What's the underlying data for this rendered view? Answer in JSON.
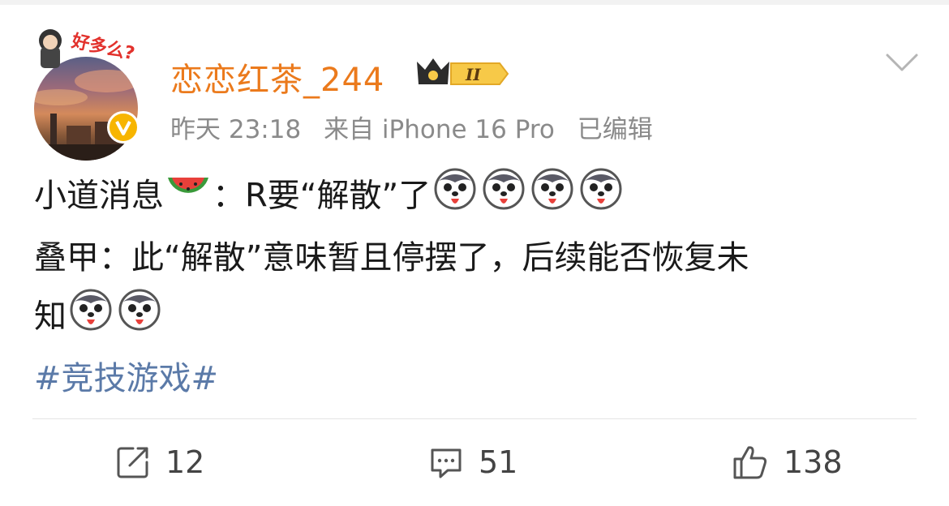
{
  "post": {
    "username": "恋恋红茶_244",
    "vip_level": "II",
    "meta": {
      "time": "昨天 23:18",
      "source": "来自 iPhone 16 Pro",
      "edited": "已编辑"
    },
    "content": {
      "line1_text_a": "小道消息",
      "line1_text_b": "：R要“解散”了",
      "line2_text": "叠甲：此“解散”意味暂且停摆了，后续能否恢复未",
      "line3_text": "知",
      "hashtag": "#竞技游戏#"
    },
    "icons": {
      "melon": "watermelon-emoji",
      "husky": "husky-dog-emoji",
      "verified": "verified-v-badge-icon",
      "chevron": "chevron-down-icon"
    },
    "actions": {
      "repost_count": "12",
      "comment_count": "51",
      "like_count": "138"
    }
  }
}
